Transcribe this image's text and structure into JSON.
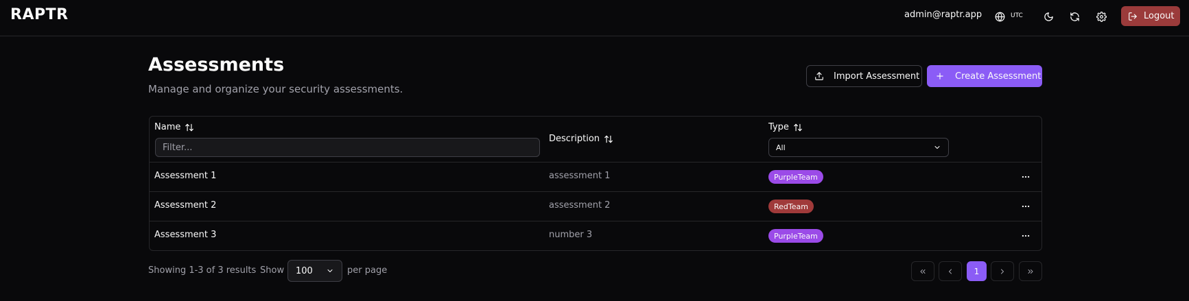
{
  "app": {
    "brand": "RAPTR"
  },
  "header": {
    "user_email": "admin@raptr.app",
    "timezone": "UTC",
    "logout_label": "Logout",
    "icons": [
      "globe-icon",
      "moon-icon",
      "refresh-icon",
      "gear-icon",
      "logout-icon"
    ]
  },
  "page": {
    "title": "Assessments",
    "subtitle": "Manage and organize your security assessments.",
    "import_label": "Import Assessment",
    "create_label": "Create Assessment"
  },
  "table": {
    "columns": {
      "name": "Name",
      "description": "Description",
      "type": "Type"
    },
    "filter_placeholder": "Filter...",
    "type_filter_value": "All",
    "rows": [
      {
        "name": "Assessment 1",
        "description": "assessment 1",
        "type": "PurpleTeam",
        "type_color": "#9b4be8"
      },
      {
        "name": "Assessment 2",
        "description": "assessment 2",
        "type": "RedTeam",
        "type_color": "#a03a3a"
      },
      {
        "name": "Assessment 3",
        "description": "number 3",
        "type": "PurpleTeam",
        "type_color": "#9b4be8"
      }
    ]
  },
  "pagination": {
    "results_text": "Showing 1-3 of 3 results",
    "show_label": "Show",
    "per_page_value": "100",
    "per_page_suffix": "per page",
    "current_page": "1"
  },
  "colors": {
    "background": "#09090b",
    "accent": "#8b5cf6",
    "logout": "#9b3b3b",
    "border": "#27272a"
  }
}
